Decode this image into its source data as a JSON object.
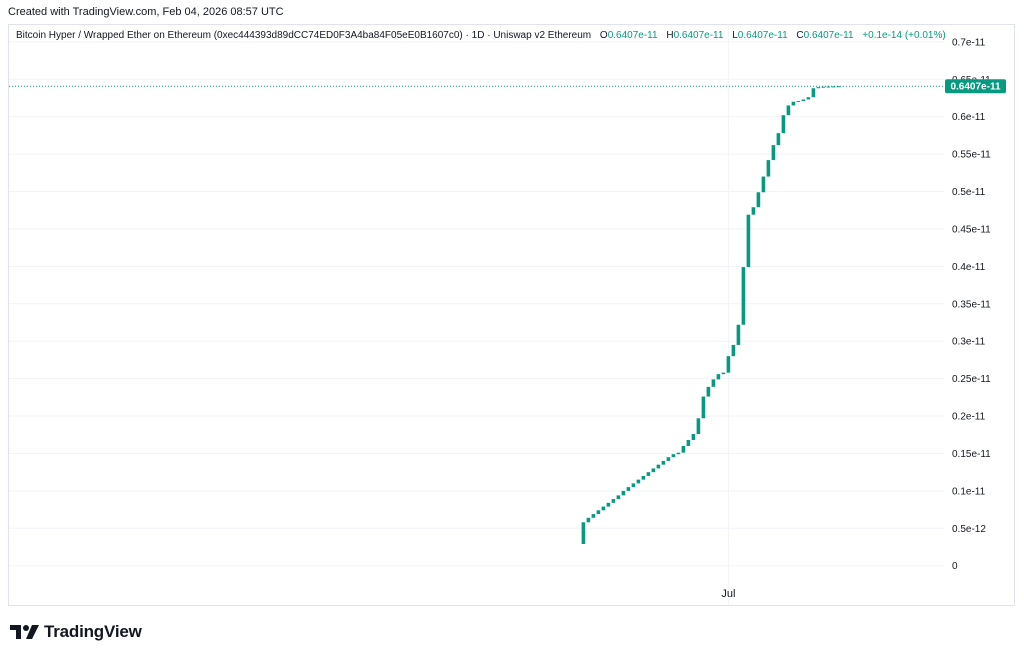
{
  "header": {
    "created": "Created with TradingView.com, Feb 04, 2026 08:57 UTC"
  },
  "legend": {
    "symbol": "Bitcoin Hyper / Wrapped Ether on Ethereum (0xec444393d89dCC74ED0F3A4ba84F05eE0B1607c0) · 1D · Uniswap v2 Ethereum",
    "o_label": "O",
    "o_value": "0.6407e-11",
    "h_label": "H",
    "h_value": "0.6407e-11",
    "l_label": "L",
    "l_value": "0.6407e-11",
    "c_label": "C",
    "c_value": "0.6407e-11",
    "change": "+0.1e-14 (+0.01%)"
  },
  "footer": {
    "brand": "TradingView"
  },
  "colors": {
    "up": "#089981",
    "grid": "#f0f3fa",
    "text": "#131722",
    "border": "#e0e3eb"
  },
  "chart_data": {
    "type": "candlestick",
    "y_ticks": [
      {
        "value": 0.7,
        "label": "0.7e-11"
      },
      {
        "value": 0.65,
        "label": "0.65e-11"
      },
      {
        "value": 0.6,
        "label": "0.6e-11"
      },
      {
        "value": 0.55,
        "label": "0.55e-11"
      },
      {
        "value": 0.5,
        "label": "0.5e-11"
      },
      {
        "value": 0.45,
        "label": "0.45e-11"
      },
      {
        "value": 0.4,
        "label": "0.4e-11"
      },
      {
        "value": 0.35,
        "label": "0.35e-11"
      },
      {
        "value": 0.3,
        "label": "0.3e-11"
      },
      {
        "value": 0.25,
        "label": "0.25e-11"
      },
      {
        "value": 0.2,
        "label": "0.2e-11"
      },
      {
        "value": 0.15,
        "label": "0.15e-11"
      },
      {
        "value": 0.1,
        "label": "0.1e-11"
      },
      {
        "value": 0.05,
        "label": "0.5e-12"
      },
      {
        "value": 0.0,
        "label": "0"
      }
    ],
    "x_tick": {
      "label": "Jul",
      "bar_index": 29
    },
    "last_price": {
      "value": 0.6407,
      "label": "0.6407e-11"
    },
    "ylim": [
      -0.0525,
      0.7225
    ],
    "bars": [
      {
        "o": 0.029,
        "c": 0.058
      },
      {
        "o": 0.058,
        "c": 0.064
      },
      {
        "o": 0.064,
        "c": 0.069
      },
      {
        "o": 0.069,
        "c": 0.074
      },
      {
        "o": 0.074,
        "c": 0.079
      },
      {
        "o": 0.079,
        "c": 0.084
      },
      {
        "o": 0.084,
        "c": 0.089
      },
      {
        "o": 0.089,
        "c": 0.094
      },
      {
        "o": 0.094,
        "c": 0.1
      },
      {
        "o": 0.1,
        "c": 0.105
      },
      {
        "o": 0.105,
        "c": 0.11
      },
      {
        "o": 0.11,
        "c": 0.115
      },
      {
        "o": 0.115,
        "c": 0.12
      },
      {
        "o": 0.12,
        "c": 0.125
      },
      {
        "o": 0.125,
        "c": 0.13
      },
      {
        "o": 0.13,
        "c": 0.135
      },
      {
        "o": 0.135,
        "c": 0.14
      },
      {
        "o": 0.14,
        "c": 0.145
      },
      {
        "o": 0.145,
        "c": 0.149
      },
      {
        "o": 0.149,
        "c": 0.151
      },
      {
        "o": 0.151,
        "c": 0.16
      },
      {
        "o": 0.16,
        "c": 0.168
      },
      {
        "o": 0.168,
        "c": 0.176
      },
      {
        "o": 0.176,
        "c": 0.197
      },
      {
        "o": 0.197,
        "c": 0.226
      },
      {
        "o": 0.226,
        "c": 0.239
      },
      {
        "o": 0.239,
        "c": 0.249
      },
      {
        "o": 0.249,
        "c": 0.256
      },
      {
        "o": 0.256,
        "c": 0.258
      },
      {
        "o": 0.258,
        "c": 0.28
      },
      {
        "o": 0.28,
        "c": 0.295
      },
      {
        "o": 0.295,
        "c": 0.322
      },
      {
        "o": 0.322,
        "c": 0.399
      },
      {
        "o": 0.399,
        "c": 0.469
      },
      {
        "o": 0.469,
        "c": 0.479
      },
      {
        "o": 0.479,
        "c": 0.499
      },
      {
        "o": 0.499,
        "c": 0.52
      },
      {
        "o": 0.52,
        "c": 0.542
      },
      {
        "o": 0.542,
        "c": 0.562
      },
      {
        "o": 0.562,
        "c": 0.578
      },
      {
        "o": 0.578,
        "c": 0.602
      },
      {
        "o": 0.602,
        "c": 0.615
      },
      {
        "o": 0.615,
        "c": 0.62
      },
      {
        "o": 0.62,
        "c": 0.621
      },
      {
        "o": 0.621,
        "c": 0.623
      },
      {
        "o": 0.623,
        "c": 0.626
      },
      {
        "o": 0.626,
        "c": 0.638
      },
      {
        "o": 0.638,
        "c": 0.6395
      },
      {
        "o": 0.6395,
        "c": 0.64
      },
      {
        "o": 0.64,
        "c": 0.6403
      },
      {
        "o": 0.6403,
        "c": 0.6405
      },
      {
        "o": 0.6405,
        "c": 0.6407
      }
    ]
  }
}
